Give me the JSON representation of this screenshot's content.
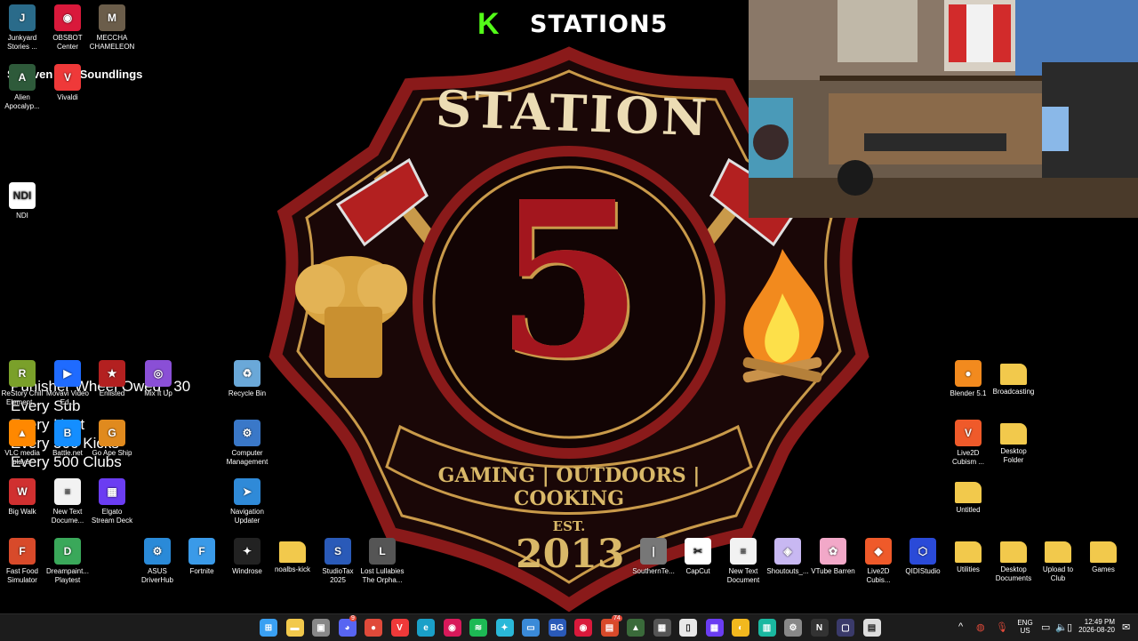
{
  "stream": {
    "title": "STATION5",
    "kick_letter": "K",
    "top_text": "Shreven The Soundlings"
  },
  "emblem": {
    "name": "STATION",
    "number": "5",
    "motto": "GAMING | OUTDOORS | COOKING",
    "est": "EST.",
    "year": "2013"
  },
  "overlay": {
    "lines": [
      "Punisher Wheel Owed : 30",
      "Every Sub",
      "Every Host",
      "Every 500 Kicks",
      "Every 500 Clubs"
    ]
  },
  "desktop_icons": [
    {
      "label": "Junkyard\nStories ...",
      "icon": "game-icon",
      "color": "#2a6b8a",
      "glyph": "J"
    },
    {
      "label": "OBSBOT\nCenter",
      "icon": "obsbot-icon",
      "color": "#d9193b",
      "glyph": "◉"
    },
    {
      "label": "MECCHA\nCHAMELEON",
      "icon": "game-icon",
      "color": "#6b5d4a",
      "glyph": "M"
    },
    {
      "label": "Alien\nApocalyp...",
      "icon": "game-icon",
      "color": "#2e5a3a",
      "glyph": "A"
    },
    {
      "label": "Vivaldi",
      "icon": "vivaldi-icon",
      "color": "#ef3939",
      "glyph": "V"
    },
    {
      "label": "NDI",
      "icon": "ndi-icon",
      "color": "#ffffff",
      "glyph": "NDI"
    },
    {
      "label": "ReStory Chill\nElement...",
      "icon": "game-icon",
      "color": "#7aa02a",
      "glyph": "R"
    },
    {
      "label": "Movavi Video\nEd...",
      "icon": "movavi-icon",
      "color": "#1f6bff",
      "glyph": "▶"
    },
    {
      "label": "Enlisted",
      "icon": "enlisted-icon",
      "color": "#b32020",
      "glyph": "★"
    },
    {
      "label": "Mix It Up",
      "icon": "mixitup-icon",
      "color": "#8a4fd6",
      "glyph": "◎"
    },
    {
      "label": "Recycle Bin",
      "icon": "recycle-bin-icon",
      "color": "#6aa8d8",
      "glyph": "♻"
    },
    {
      "label": "VLC media\nplayer",
      "icon": "vlc-icon",
      "color": "#ff8800",
      "glyph": "▲"
    },
    {
      "label": "Battle.net",
      "icon": "battlenet-icon",
      "color": "#148eff",
      "glyph": "B"
    },
    {
      "label": "Go Ape Ship",
      "icon": "game-icon",
      "color": "#e08a1e",
      "glyph": "G"
    },
    {
      "label": "Computer\nManagement",
      "icon": "computer-management-icon",
      "color": "#3a78c8",
      "glyph": "⚙"
    },
    {
      "label": "Big Walk",
      "icon": "game-icon",
      "color": "#d03030",
      "glyph": "W"
    },
    {
      "label": "New Text\nDocume...",
      "icon": "text-document-icon",
      "color": "#f2f2f2",
      "glyph": "≡"
    },
    {
      "label": "Elgato\nStream Deck",
      "icon": "streamdeck-icon",
      "color": "#6b3df2",
      "glyph": "▦"
    },
    {
      "label": "Navigation\nUpdater",
      "icon": "navigation-icon",
      "color": "#2f8ad8",
      "glyph": "➤"
    },
    {
      "label": "Blender 5.1",
      "icon": "blender-icon",
      "color": "#f28a1e",
      "glyph": "●"
    },
    {
      "label": "Broadcasting",
      "icon": "folder-icon",
      "color": "#f2c94c",
      "glyph": ""
    },
    {
      "label": "Live2D\nCubism ...",
      "icon": "live2d-icon",
      "color": "#ef5a2a",
      "glyph": "V"
    },
    {
      "label": "Desktop\nFolder",
      "icon": "folder-icon",
      "color": "#f2c94c",
      "glyph": ""
    },
    {
      "label": "Untitled",
      "icon": "folder-icon",
      "color": "#f2c94c",
      "glyph": ""
    },
    {
      "label": "Fast Food\nSimulator",
      "icon": "game-icon",
      "color": "#d84a2a",
      "glyph": "F"
    },
    {
      "label": "Dreampaint...\nPlaytest",
      "icon": "game-icon",
      "color": "#3aa85a",
      "glyph": "D"
    },
    {
      "label": "ASUS\nDriverHub",
      "icon": "asus-icon",
      "color": "#2a8ad8",
      "glyph": "⚙"
    },
    {
      "label": "Fortnite",
      "icon": "fortnite-icon",
      "color": "#3a9ae8",
      "glyph": "F"
    },
    {
      "label": "Windrose",
      "icon": "game-icon",
      "color": "#222222",
      "glyph": "✦"
    },
    {
      "label": "noalbs-kick",
      "icon": "folder-icon",
      "color": "#f2c94c",
      "glyph": ""
    },
    {
      "label": "StudioTax\n2025",
      "icon": "studiotax-icon",
      "color": "#2a5ab8",
      "glyph": "S"
    },
    {
      "label": "Lost Lullabies\nThe Orpha...",
      "icon": "game-icon",
      "color": "#555555",
      "glyph": "L"
    },
    {
      "label": "SouthernTe...",
      "icon": "game-icon",
      "color": "#777777",
      "glyph": "|"
    },
    {
      "label": "CapCut",
      "icon": "capcut-icon",
      "color": "#ffffff",
      "glyph": "✂"
    },
    {
      "label": "New Text\nDocument",
      "icon": "text-document-icon",
      "color": "#f2f2f2",
      "glyph": "≡"
    },
    {
      "label": "Shoutouts_...",
      "icon": "shoutouts-icon",
      "color": "#c8b8f2",
      "glyph": "◈"
    },
    {
      "label": "VTube Barren",
      "icon": "vtube-icon",
      "color": "#f2a8c8",
      "glyph": "✿"
    },
    {
      "label": "Live2D\nCubis...",
      "icon": "live2d-icon",
      "color": "#ef5a2a",
      "glyph": "◆"
    },
    {
      "label": "QIDIStudio",
      "icon": "qidi-icon",
      "color": "#2a4ad8",
      "glyph": "⬡"
    },
    {
      "label": "Utilities",
      "icon": "folder-icon",
      "color": "#f2c94c",
      "glyph": ""
    },
    {
      "label": "Desktop\nDocuments",
      "icon": "folder-icon",
      "color": "#f2c94c",
      "glyph": ""
    },
    {
      "label": "Upload to\nClub",
      "icon": "folder-icon",
      "color": "#f2c94c",
      "glyph": ""
    },
    {
      "label": "Games",
      "icon": "folder-icon",
      "color": "#f2c94c",
      "glyph": ""
    }
  ],
  "taskbar": {
    "apps": [
      {
        "name": "start-icon",
        "glyph": "⊞",
        "color": "#3aa0f2"
      },
      {
        "name": "file-explorer-icon",
        "glyph": "▬",
        "color": "#f2c94c"
      },
      {
        "name": "store-icon",
        "glyph": "▣",
        "color": "#888888"
      },
      {
        "name": "discord-icon",
        "glyph": "◕",
        "color": "#5865f2"
      },
      {
        "name": "chrome-icon",
        "glyph": "●",
        "color": "#e04a3a"
      },
      {
        "name": "vivaldi-icon",
        "glyph": "V",
        "color": "#ef3939"
      },
      {
        "name": "edge-icon",
        "glyph": "e",
        "color": "#1aa0c8"
      },
      {
        "name": "app-icon",
        "glyph": "◉",
        "color": "#d8195a"
      },
      {
        "name": "spotify-icon",
        "glyph": "≋",
        "color": "#1db954"
      },
      {
        "name": "app-icon",
        "glyph": "✦",
        "color": "#2ab8d8"
      },
      {
        "name": "app-icon",
        "glyph": "▭",
        "color": "#3a8ad8"
      },
      {
        "name": "bg-icon",
        "glyph": "BG",
        "color": "#2a5ab8"
      },
      {
        "name": "obsbot-icon",
        "glyph": "◉",
        "color": "#d9193b"
      },
      {
        "name": "app-icon",
        "glyph": "▤",
        "color": "#d84a2a"
      },
      {
        "name": "app-icon",
        "glyph": "▲",
        "color": "#3a6a3a"
      },
      {
        "name": "calculator-icon",
        "glyph": "▦",
        "color": "#555555"
      },
      {
        "name": "notepad-icon",
        "glyph": "▯",
        "color": "#e8e8e8"
      },
      {
        "name": "app-icon",
        "glyph": "▦",
        "color": "#6b3df2"
      },
      {
        "name": "app-icon",
        "glyph": "◐",
        "color": "#f2b81e"
      },
      {
        "name": "audio-icon",
        "glyph": "▥",
        "color": "#1ab8a0"
      },
      {
        "name": "settings-icon",
        "glyph": "⚙",
        "color": "#888888"
      },
      {
        "name": "ndi-icon",
        "glyph": "N",
        "color": "#333333"
      },
      {
        "name": "app-icon",
        "glyph": "▢",
        "color": "#3a3a6a"
      },
      {
        "name": "app-icon",
        "glyph": "▤",
        "color": "#dddddd"
      }
    ],
    "badges": {
      "discord": "9",
      "app": "74"
    },
    "lang": "ENG",
    "region": "US",
    "time": "12:49 PM",
    "date": "2026-08-20"
  }
}
